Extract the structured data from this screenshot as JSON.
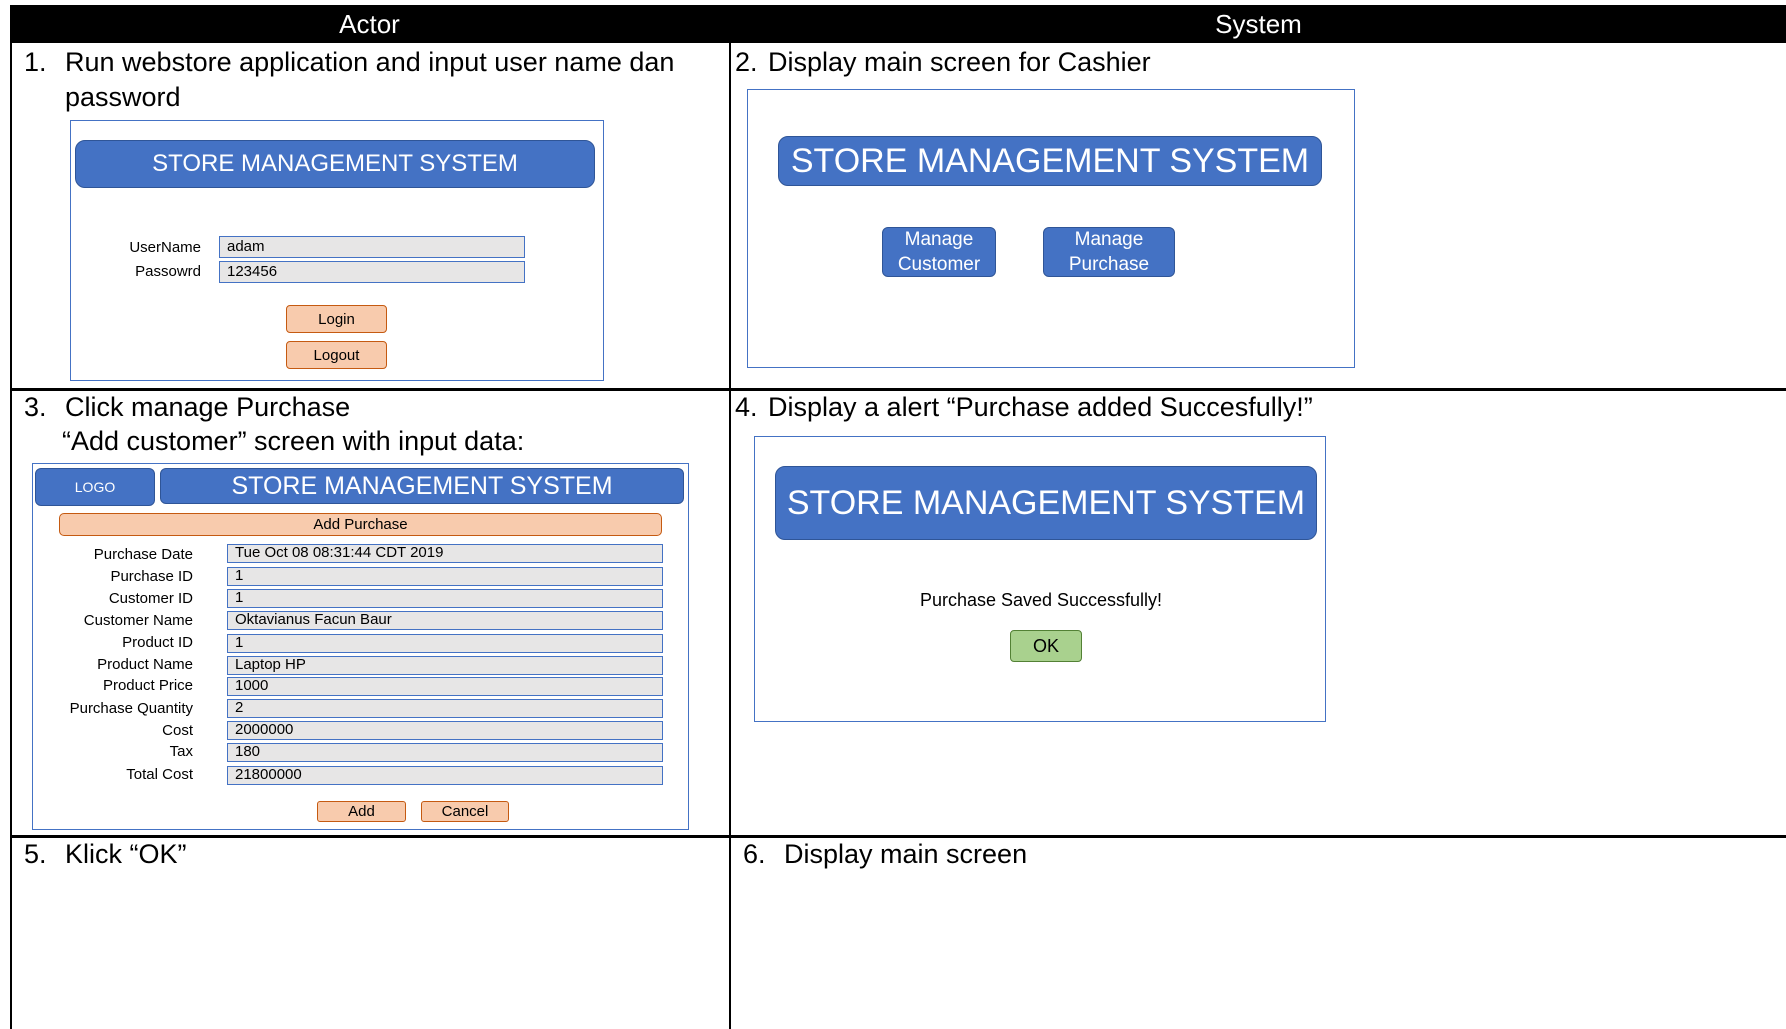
{
  "table": {
    "headers": {
      "actor": "Actor",
      "system": "System"
    }
  },
  "rows": [
    {
      "actor_step": {
        "number": "1.",
        "text_line1": "Run webstore application and input user name dan",
        "text_line2": "password"
      },
      "system_step": {
        "number": "2.",
        "text": "Display main screen for Cashier"
      }
    },
    {
      "actor_step": {
        "number": "3.",
        "text_line1": "Click manage Purchase",
        "text_line2": "“Add customer” screen with input data:"
      },
      "system_step": {
        "number": "4.",
        "text": "Display a alert “Purchase added Succesfully!”"
      }
    },
    {
      "actor_step": {
        "number": "5.",
        "text_line1": "Klick “OK”"
      },
      "system_step": {
        "number": "6.",
        "text": "Display main screen"
      }
    }
  ],
  "login_mock": {
    "banner": "STORE MANAGEMENT SYSTEM",
    "username_label": "UserName",
    "username_value": "adam",
    "password_label": "Passowrd",
    "password_value": "123456",
    "login_button": "Login",
    "logout_button": "Logout"
  },
  "main_mock": {
    "banner": "STORE MANAGEMENT SYSTEM",
    "manage_customer_line1": "Manage",
    "manage_customer_line2": "Customer",
    "manage_purchase_line1": "Manage",
    "manage_purchase_line2": "Purchase"
  },
  "purchase_mock": {
    "logo": "LOGO",
    "banner": "STORE MANAGEMENT SYSTEM",
    "section_title": "Add Purchase",
    "fields": [
      {
        "label": "Purchase Date",
        "value": "Tue Oct 08 08:31:44 CDT 2019"
      },
      {
        "label": "Purchase ID",
        "value": "1"
      },
      {
        "label": "Customer ID",
        "value": "1"
      },
      {
        "label": "Customer Name",
        "value": "Oktavianus Facun Baur"
      },
      {
        "label": "Product ID",
        "value": "1"
      },
      {
        "label": "Product Name",
        "value": "Laptop HP"
      },
      {
        "label": "Product Price",
        "value": "1000"
      },
      {
        "label": "Purchase Quantity",
        "value": "2"
      },
      {
        "label": "Cost",
        "value": "2000000"
      },
      {
        "label": "Tax",
        "value": "180"
      },
      {
        "label": "Total Cost",
        "value": "21800000"
      }
    ],
    "add_button": "Add",
    "cancel_button": "Cancel"
  },
  "alert_mock": {
    "banner": "STORE MANAGEMENT SYSTEM",
    "message": "Purchase Saved Successfully!",
    "ok_button": "OK"
  },
  "colors": {
    "banner_blue": "#4472c4",
    "orange_button": "#f8cbad",
    "ok_green": "#a9d18e",
    "field_gray": "#e7e6e6"
  }
}
